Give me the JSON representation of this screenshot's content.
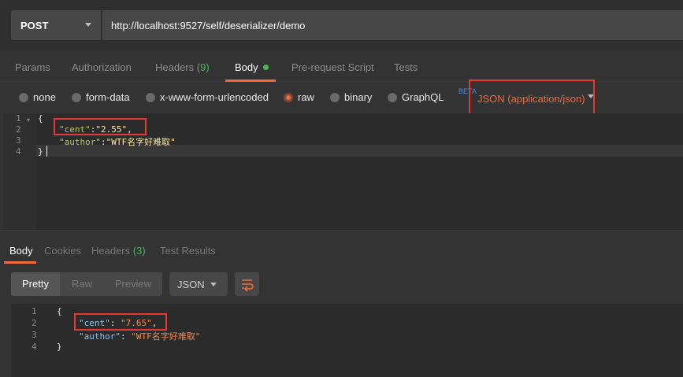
{
  "request": {
    "method": "POST",
    "url": "http://localhost:9527/self/deserializer/demo"
  },
  "tabs": [
    {
      "label": "Params"
    },
    {
      "label": "Authorization"
    },
    {
      "label": "Headers",
      "count": "(9)"
    },
    {
      "label": "Body"
    },
    {
      "label": "Pre-request Script"
    },
    {
      "label": "Tests"
    }
  ],
  "body_types": [
    {
      "label": "none"
    },
    {
      "label": "form-data"
    },
    {
      "label": "x-www-form-urlencoded"
    },
    {
      "label": "raw",
      "selected": true
    },
    {
      "label": "binary"
    },
    {
      "label": "GraphQL",
      "badge": "BETA"
    }
  ],
  "content_type": "JSON (application/json)",
  "request_editor": {
    "line_numbers": [
      "1",
      "2",
      "3",
      "4"
    ],
    "lines": [
      "{",
      "\"cent\"",
      ":",
      "\"2.55\"",
      ",",
      "\"author\"",
      ":",
      "\"WTF名字好难取\"",
      "}"
    ]
  },
  "response_tabs": [
    {
      "label": "Body"
    },
    {
      "label": "Cookies"
    },
    {
      "label": "Headers",
      "count": "(3)"
    },
    {
      "label": "Test Results"
    }
  ],
  "response_toolbar": {
    "views": [
      "Pretty",
      "Raw",
      "Preview"
    ],
    "format": "JSON"
  },
  "response_editor": {
    "line_numbers": [
      "1",
      "2",
      "3",
      "4"
    ],
    "open": "{",
    "cent_key": "\"cent\"",
    "cent_val": "\"7.65\"",
    "author_key": "\"author\"",
    "author_val": "\"WTF名字好难取\"",
    "close": "}"
  },
  "colors": {
    "accent": "#f26b3a",
    "count_green": "#4fb35b",
    "highlight_red": "#e53935"
  }
}
